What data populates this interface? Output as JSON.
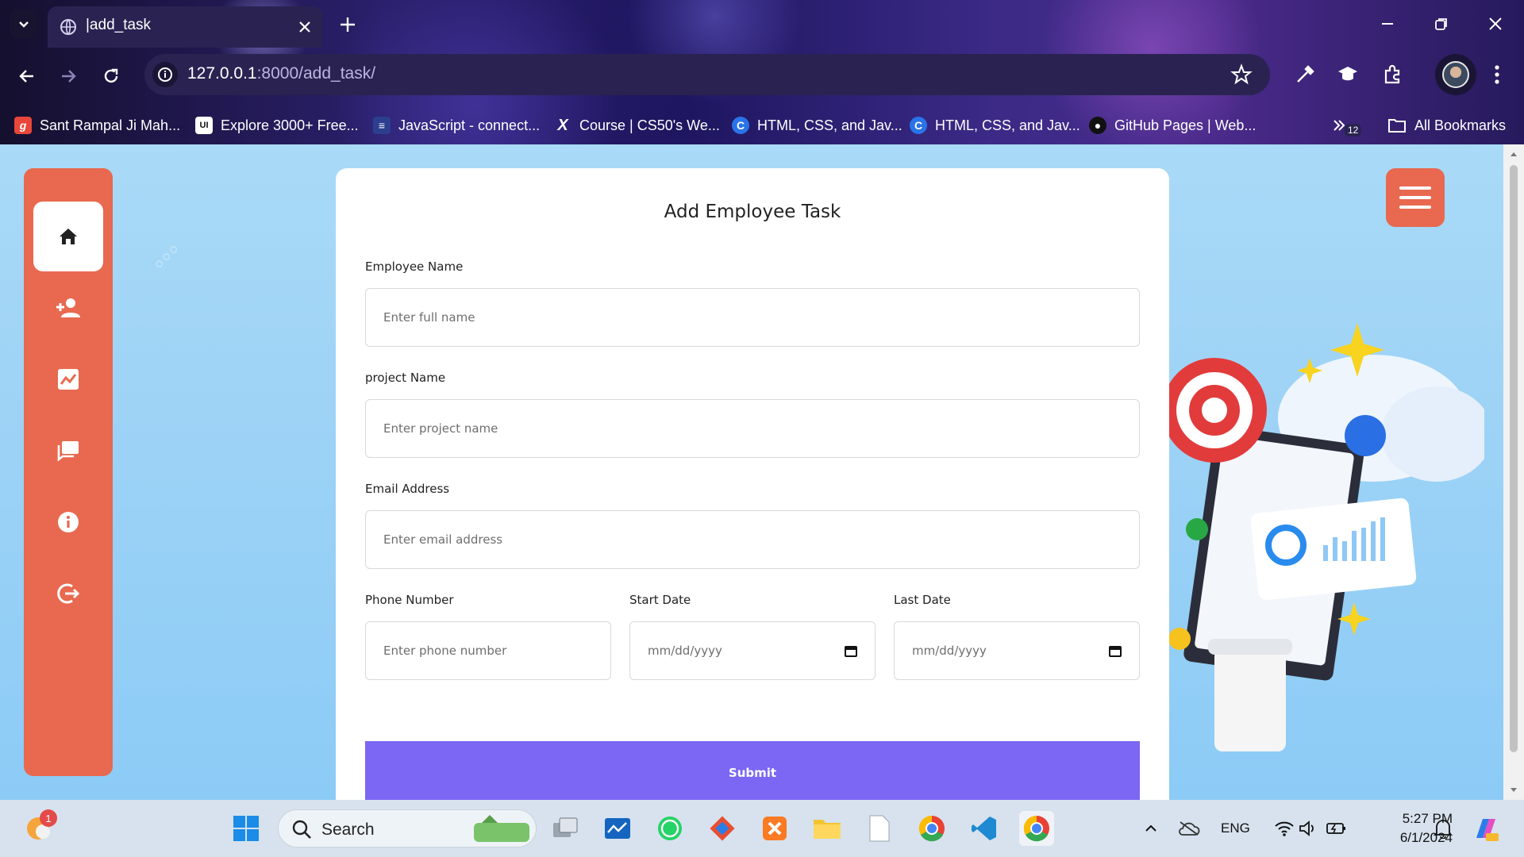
{
  "browser": {
    "tab_title": "|add_task",
    "url_host": "127.0.0.1",
    "url_path": ":8000/add_task/",
    "extension_badge": "12"
  },
  "bookmarks": [
    {
      "label": "Sant Rampal Ji Mah...",
      "icon": "g-logo-icon",
      "color": "#e8463a",
      "glyph": "g"
    },
    {
      "label": "Explore 3000+ Free...",
      "icon": "ui-logo-icon",
      "color": "#222222",
      "glyph": "UI"
    },
    {
      "label": "JavaScript - connect...",
      "icon": "stackoverflow-icon",
      "color": "#2c3f8f",
      "glyph": "≡"
    },
    {
      "label": "Course | CS50's We...",
      "icon": "edx-x-icon",
      "color": "#111111",
      "glyph": "X"
    },
    {
      "label": "HTML, CSS, and Jav...",
      "icon": "coursera-c-icon",
      "color": "#2a73e8",
      "glyph": "C"
    },
    {
      "label": "HTML, CSS, and Jav...",
      "icon": "coursera-c-icon",
      "color": "#2a73e8",
      "glyph": "C"
    },
    {
      "label": "GitHub Pages | Web...",
      "icon": "github-icon",
      "color": "#222222",
      "glyph": "●"
    }
  ],
  "all_bookmarks_label": "All Bookmarks",
  "form": {
    "title": "Add Employee Task",
    "employee_name_label": "Employee Name",
    "employee_name_placeholder": "Enter full name",
    "project_name_label": "project Name",
    "project_name_placeholder": "Enter project name",
    "email_label": "Email Address",
    "email_placeholder": "Enter email address",
    "phone_label": "Phone Number",
    "phone_placeholder": "Enter phone number",
    "start_date_label": "Start Date",
    "start_date_value": "mm/dd/yyyy",
    "last_date_label": "Last Date",
    "last_date_value": "mm/dd/yyyy",
    "submit_label": "Submit"
  },
  "sidebar": {
    "items": [
      {
        "icon": "home-icon",
        "active": true
      },
      {
        "icon": "add-user-icon",
        "active": false
      },
      {
        "icon": "chart-icon",
        "active": false
      },
      {
        "icon": "messages-icon",
        "active": false
      },
      {
        "icon": "info-icon",
        "active": false
      },
      {
        "icon": "logout-icon",
        "active": false
      }
    ]
  },
  "colors": {
    "accent": "#e8694f",
    "submit": "#7b67f3",
    "page_bg": "#9ed3f6"
  },
  "taskbar": {
    "search_label": "Search",
    "notification_count": "1",
    "language": "ENG",
    "time": "5:27 PM",
    "date": "6/1/2024"
  }
}
